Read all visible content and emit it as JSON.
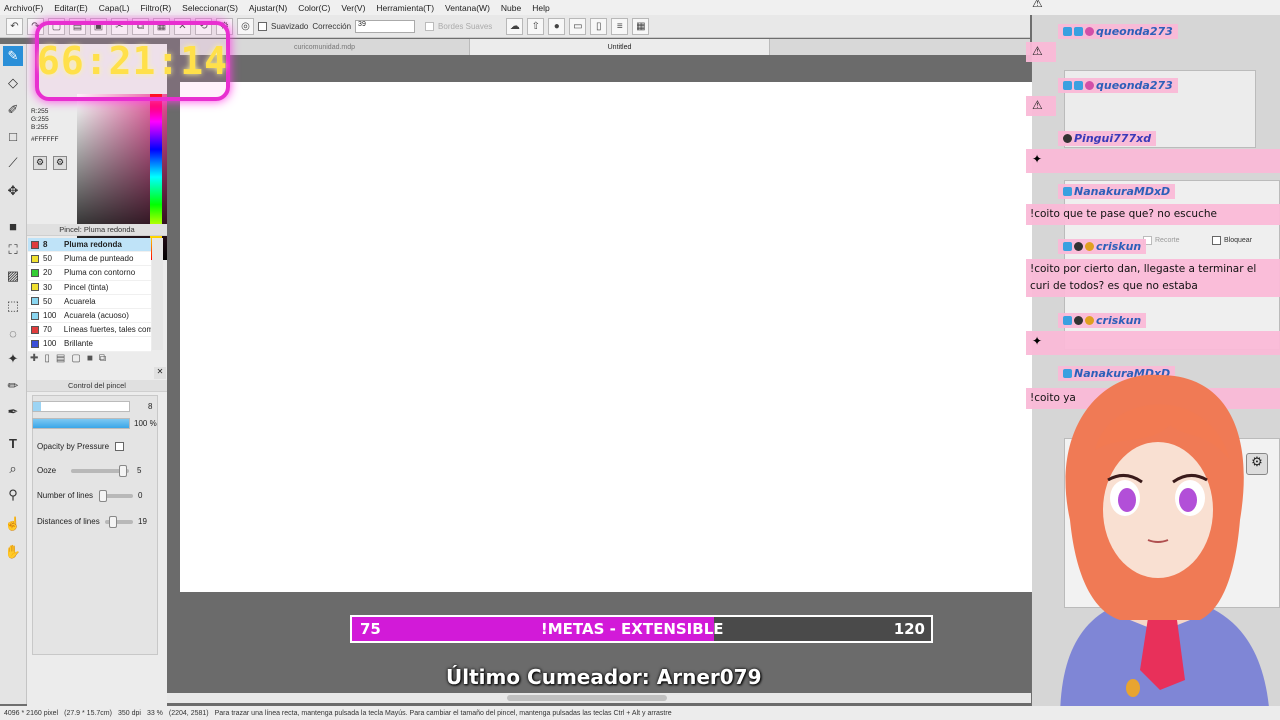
{
  "menu": [
    "Archivo(F)",
    "Editar(E)",
    "Capa(L)",
    "Filtro(R)",
    "Seleccionar(S)",
    "Ajustar(N)",
    "Color(C)",
    "Ver(V)",
    "Herramienta(T)",
    "Ventana(W)",
    "Nube",
    "Help"
  ],
  "toolbar": {
    "smooth_label": "Suavizado",
    "correction_label": "Corrección",
    "correction_value": "39",
    "soft_edges_label": "Bordes Suaves"
  },
  "tabs": [
    "curicomunidad.mdp",
    "Untitled"
  ],
  "color": {
    "r": "R:255",
    "g": "G:255",
    "b": "B:255",
    "hex": "#FFFFFF"
  },
  "brush_panel": {
    "title": "Pincel: Pluma redonda",
    "brushes": [
      {
        "size": "8",
        "name": "Pluma redonda",
        "color": "#e03c3c",
        "selected": true
      },
      {
        "size": "50",
        "name": "Pluma de punteado",
        "color": "#f0e030"
      },
      {
        "size": "20",
        "name": "Pluma con contorno",
        "color": "#33cc33"
      },
      {
        "size": "30",
        "name": "Pincel (tinta)",
        "color": "#f0e030"
      },
      {
        "size": "50",
        "name": "Acuarela",
        "color": "#8ad6f0"
      },
      {
        "size": "100",
        "name": "Acuarela (acuoso)",
        "color": "#8ad6f0"
      },
      {
        "size": "70",
        "name": "Líneas fuertes, tales com",
        "color": "#e03c3c"
      },
      {
        "size": "100",
        "name": "Brillante",
        "color": "#3a4fd8"
      }
    ]
  },
  "brush_control": {
    "title": "Control del pincel",
    "size_value": "8",
    "size_fraction": 0.08,
    "opacity_value": "100 %",
    "opacity_fraction": 1.0,
    "pressure_label": "Opacity by Pressure",
    "ooze_label": "Ooze",
    "ooze_value": "5",
    "ooze_fraction": 0.95,
    "lines_label": "Number of lines",
    "lines_value": "0",
    "lines_fraction": 0.0,
    "dist_label": "Distances of lines",
    "dist_value": "19",
    "dist_fraction": 0.2
  },
  "overlay": {
    "timer": "66:21:14",
    "goal_left": "75",
    "goal_label": "!METAS - EXTENSIBLE",
    "goal_right": "120",
    "goal_fraction": 0.625,
    "last_cum": "Último Cumeador: Arner079"
  },
  "chat": [
    {
      "user": "queonda273"
    },
    {
      "user": "queonda273"
    },
    {
      "user": "Pingui777xd"
    },
    {
      "user": "NanakuraMDxD",
      "text": "!coito que te pase que? no escuche"
    },
    {
      "user": "criskun",
      "text": "!coito por cierto dan, llegaste a terminar el curi de todos? es que no estaba"
    },
    {
      "user": "criskun"
    },
    {
      "user": "NanakuraMDxD",
      "text": "!coito ya"
    }
  ],
  "right_panel": {
    "cut_label": "Recorte",
    "lock_label": "Bloquear"
  },
  "status": {
    "size": "4096 * 2160 pixel",
    "phys": "(27.9 * 15.7cm)",
    "dpi": "350 dpi",
    "zoom": "33 %",
    "coords": "(2204, 2581)",
    "hint": "Para trazar una línea recta, mantenga pulsada la tecla Mayús. Para cambiar el tamaño del pincel, mantenga pulsadas las teclas Ctrl + Alt y arrastre"
  },
  "colors": {
    "accent": "#2a8fd8",
    "goal_fill": "#d21ad8",
    "timer_text": "#ffe04a",
    "timer_border": "#e82fd0",
    "chat_bg": "#fab9d7"
  }
}
